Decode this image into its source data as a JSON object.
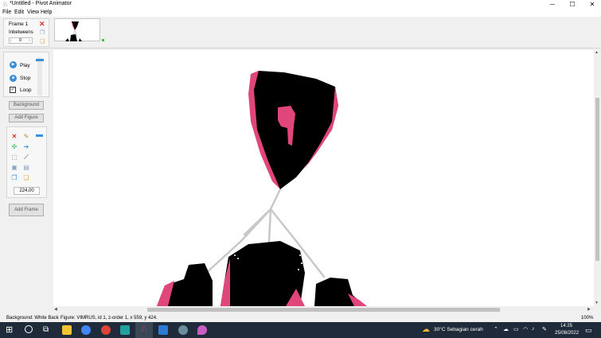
{
  "window": {
    "title": "*Untitled - Pivot Animator",
    "minimize": "─",
    "maximize": "☐",
    "close": "✕"
  },
  "menu": [
    "File",
    "Edit",
    "View",
    "Help"
  ],
  "frame_panel": {
    "frame_label": "Frame 1",
    "inbetweens_label": "Inbetweens",
    "inbetweens_value": "0"
  },
  "playback": {
    "play_label": "Play",
    "stop_label": "Stop",
    "loop_label": "Loop",
    "loop_checked": true
  },
  "buttons": {
    "background": "Background",
    "add_figure": "Add Figure",
    "add_frame": "Add Frame"
  },
  "tools": {
    "scale_value": "224,00"
  },
  "status": {
    "background": "Background: White Back",
    "figure": "Figure: VIMRUS, id 1, z-order 1, x 559, y 424.",
    "zoom": "100%"
  },
  "taskbar": {
    "weather": "30°C  Sebagian cerah",
    "time": "14:25",
    "date": "25/08/2022"
  },
  "colors": {
    "accent": "#3c8fd6",
    "figure_black": "#000000",
    "figure_pink": "#e0457b",
    "stick": "#c8c8c8",
    "taskbar": "#1f2b3a"
  }
}
